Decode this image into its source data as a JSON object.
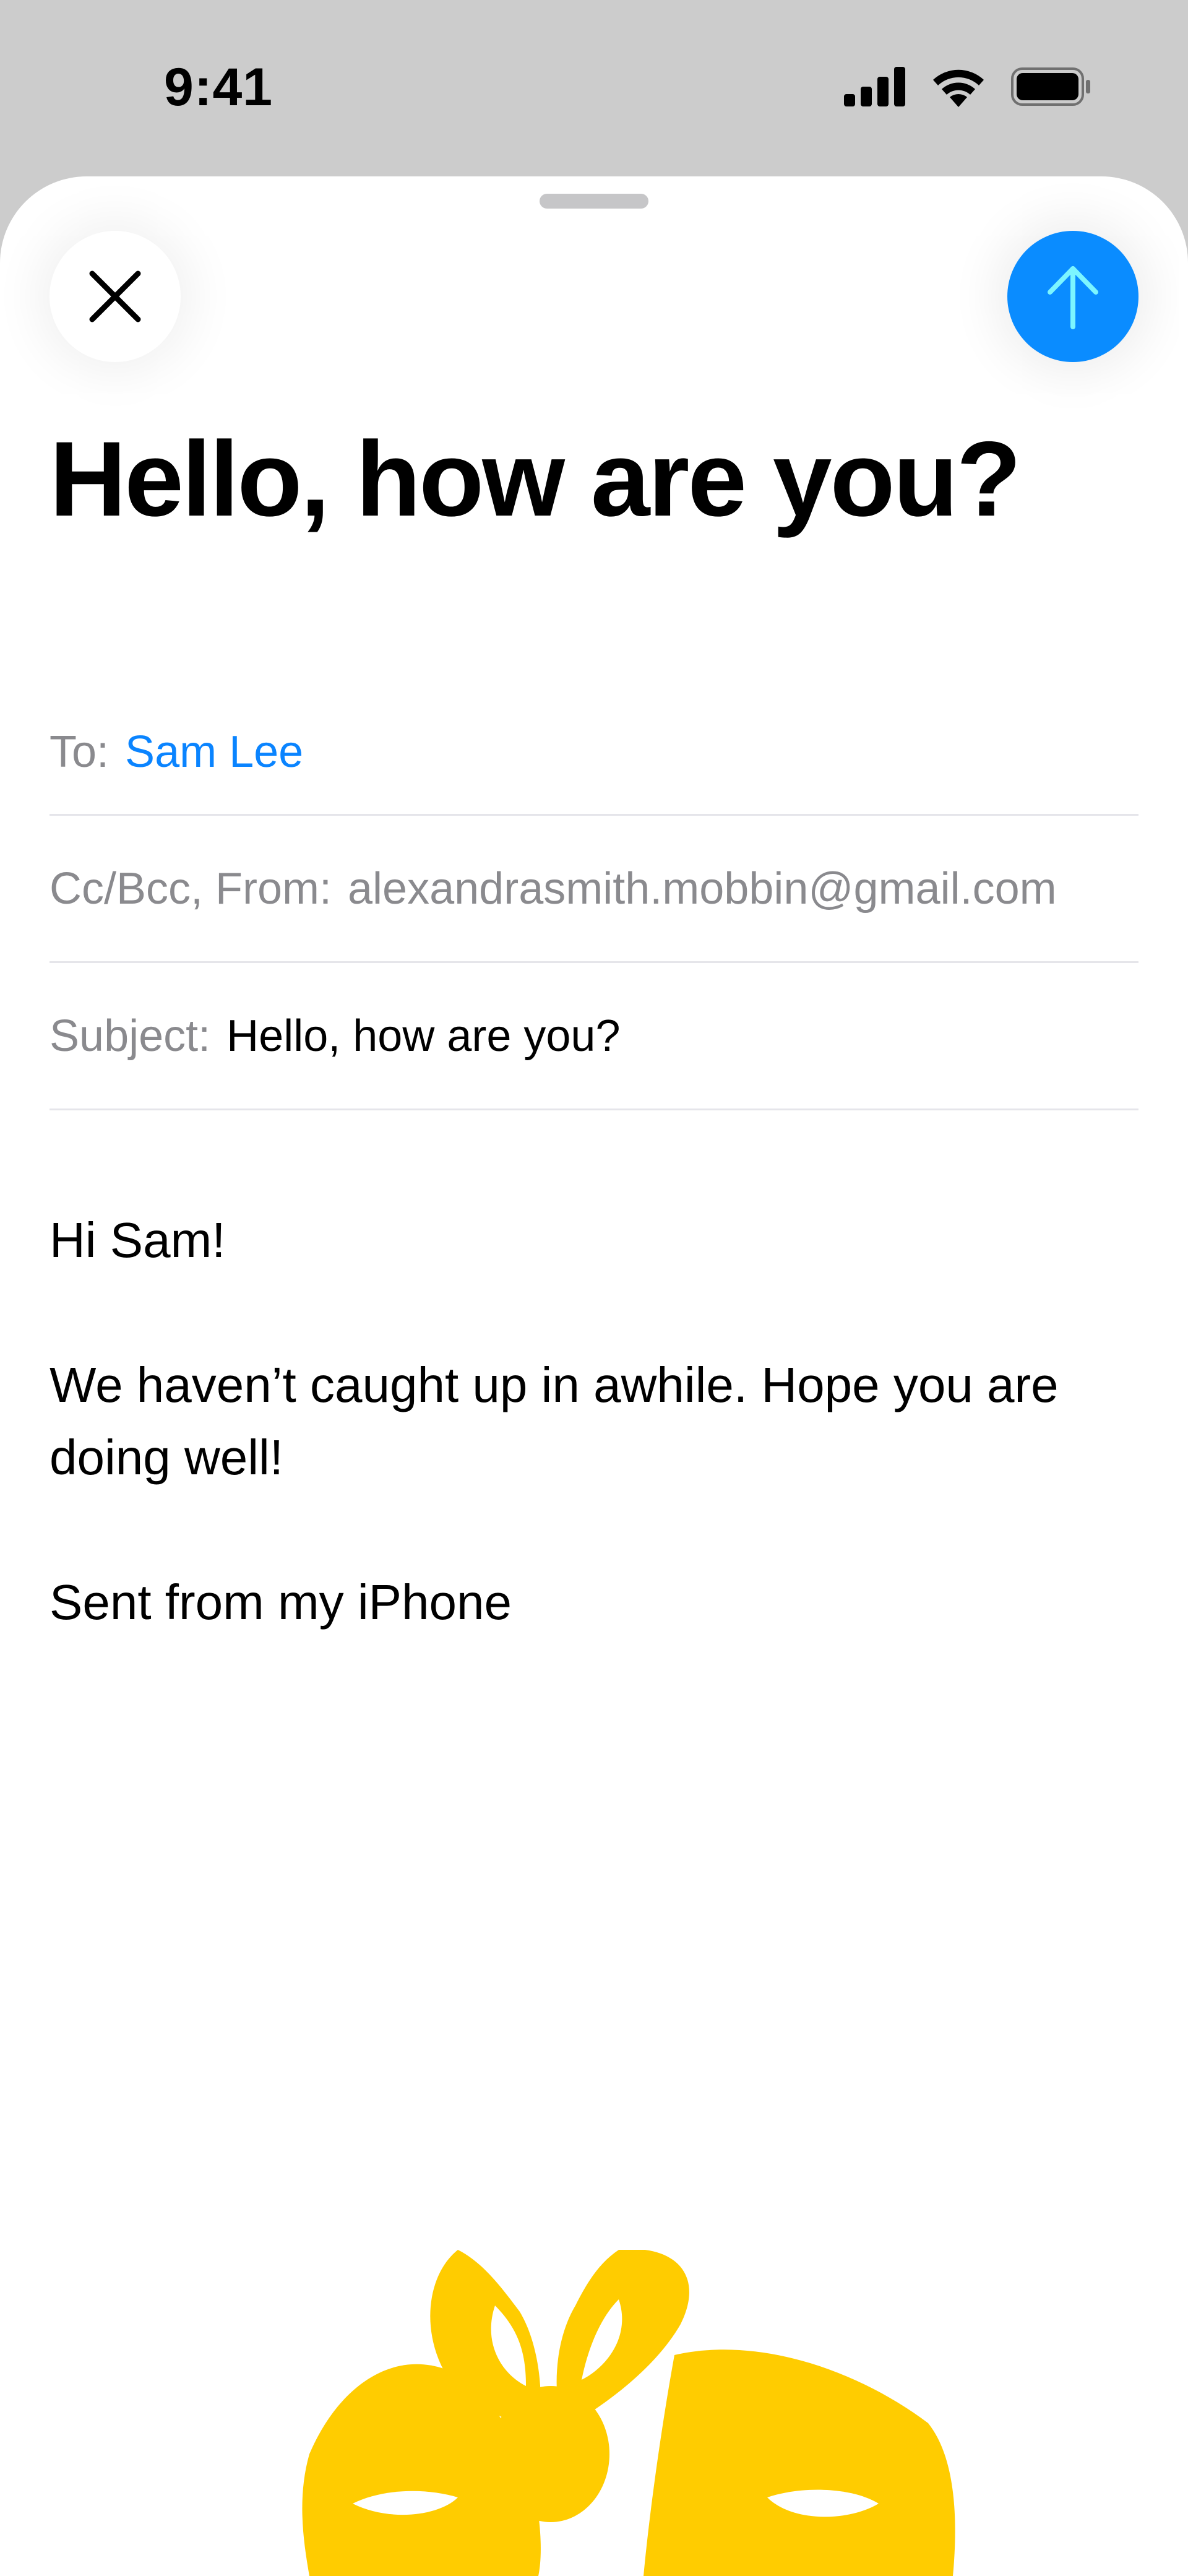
{
  "status_bar": {
    "time": "9:41",
    "icons": [
      "cellular-signal-icon",
      "wifi-icon",
      "battery-icon"
    ]
  },
  "compose": {
    "title": "Hello, how are you?",
    "close_icon": "close-icon",
    "send_icon": "send-arrow-up-icon",
    "accent_color": "#0a84ff",
    "to_label": "To:",
    "to_value": "Sam Lee",
    "cc_from_label": "Cc/Bcc, From:",
    "from_value": "alexandrasmith.mobbin@gmail.com",
    "subject_label": "Subject:",
    "subject_value": "Hello, how are you?",
    "body": {
      "greeting": "Hi Sam!",
      "message": "We haven’t caught up in awhile. Hope you are doing well!",
      "signature": "Sent from my iPhone"
    },
    "sticker": "yellow-gift-bow-sticker"
  }
}
